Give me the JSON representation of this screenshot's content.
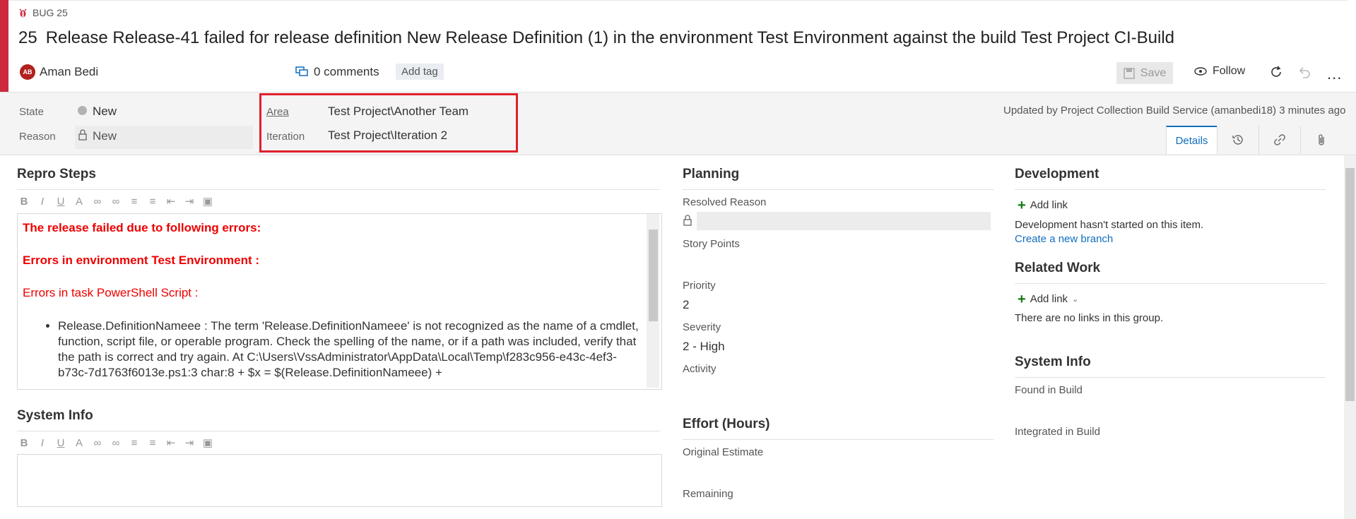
{
  "header": {
    "type_label": "BUG 25",
    "id": "25",
    "title": "Release Release-41 failed for release definition New Release Definition (1) in the environment Test Environment against the build Test Project CI-Build",
    "avatar_initials": "AB",
    "assigned_to": "Aman Bedi",
    "comments": "0 comments",
    "add_tag": "Add tag",
    "save": "Save",
    "follow": "Follow",
    "more": "..."
  },
  "info": {
    "state_label": "State",
    "state_value": "New",
    "reason_label": "Reason",
    "reason_value": "New",
    "area_label": "Area",
    "area_value": "Test Project\\Another Team",
    "iteration_label": "Iteration",
    "iteration_value": "Test Project\\Iteration 2",
    "updated": "Updated by Project Collection Build Service (amanbedi18) 3 minutes ago",
    "tab_details": "Details"
  },
  "repro": {
    "title": "Repro Steps",
    "line1": "The release failed due to following errors:",
    "line2": "Errors in environment Test Environment :",
    "line3": "Errors in task PowerShell Script :",
    "bullet": "Release.DefinitionNameee : The term 'Release.DefinitionNameee' is not recognized as the name of a cmdlet, function, script file, or operable program. Check the spelling of the name, or if a path was included, verify that the path is correct and try again. At C:\\Users\\VssAdministrator\\AppData\\Local\\Temp\\f283c956-e43c-4ef3-b73c-7d1763f6013e.ps1:3 char:8 + $x = $(Release.DefinitionNameee) +"
  },
  "sysinfo": {
    "title": "System Info"
  },
  "planning": {
    "title": "Planning",
    "resolved_reason": "Resolved Reason",
    "story_points": "Story Points",
    "priority_label": "Priority",
    "priority_value": "2",
    "severity_label": "Severity",
    "severity_value": "2 - High",
    "activity": "Activity"
  },
  "effort": {
    "title": "Effort (Hours)",
    "original": "Original Estimate",
    "remaining": "Remaining"
  },
  "development": {
    "title": "Development",
    "add_link": "Add link",
    "status": "Development hasn't started on this item.",
    "create_branch": "Create a new branch"
  },
  "related": {
    "title": "Related Work",
    "add_link": "Add link",
    "status": "There are no links in this group."
  },
  "sysinfo2": {
    "title": "System Info",
    "found": "Found in Build",
    "integrated": "Integrated in Build"
  },
  "toolbar_icons": [
    "bold-icon",
    "italic-icon",
    "underline-icon",
    "highlight-icon",
    "link-icon",
    "unlink-icon",
    "bulleted-list-icon",
    "numbered-list-icon",
    "decrease-indent-icon",
    "increase-indent-icon",
    "image-icon"
  ],
  "colors": {
    "accent": "#cc293d",
    "link": "#106ebe",
    "error": "#e00000",
    "highlight_box": "#e0202b"
  }
}
